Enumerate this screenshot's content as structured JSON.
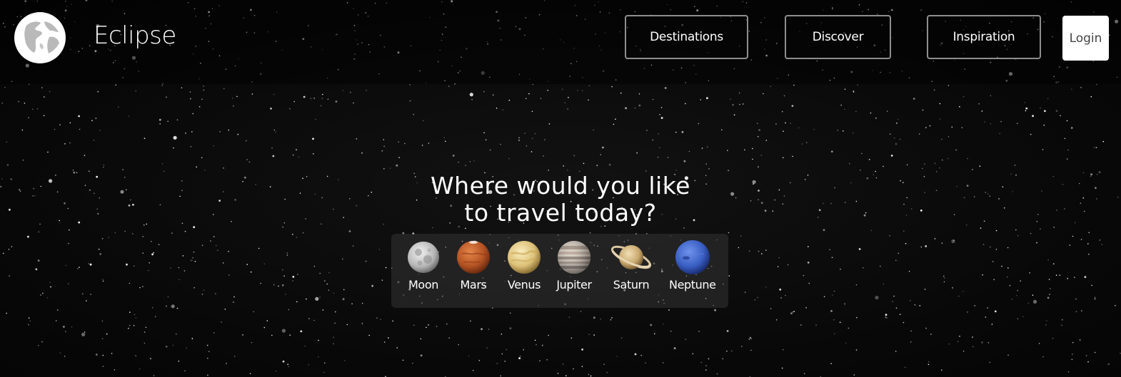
{
  "header": {
    "brand": "Eclipse",
    "nav": [
      {
        "label": "Destinations"
      },
      {
        "label": "Discover"
      },
      {
        "label": "Inspiration"
      }
    ],
    "login_label": "Login"
  },
  "hero": {
    "heading_line1": "Where would you like",
    "heading_line2": "to travel today?"
  },
  "planets": [
    {
      "label": "Moon",
      "icon": "moon-icon"
    },
    {
      "label": "Mars",
      "icon": "mars-icon"
    },
    {
      "label": "Venus",
      "icon": "venus-icon"
    },
    {
      "label": "Jupiter",
      "icon": "jupiter-icon"
    },
    {
      "label": "Saturn",
      "icon": "saturn-icon"
    },
    {
      "label": "Neptune",
      "icon": "neptune-icon"
    }
  ],
  "colors": {
    "background": "#080808",
    "header_overlay": "rgba(0,0,0,0.42)",
    "nav_border": "#8e8e8e",
    "login_bg": "#ffffff",
    "text": "#ffffff"
  }
}
